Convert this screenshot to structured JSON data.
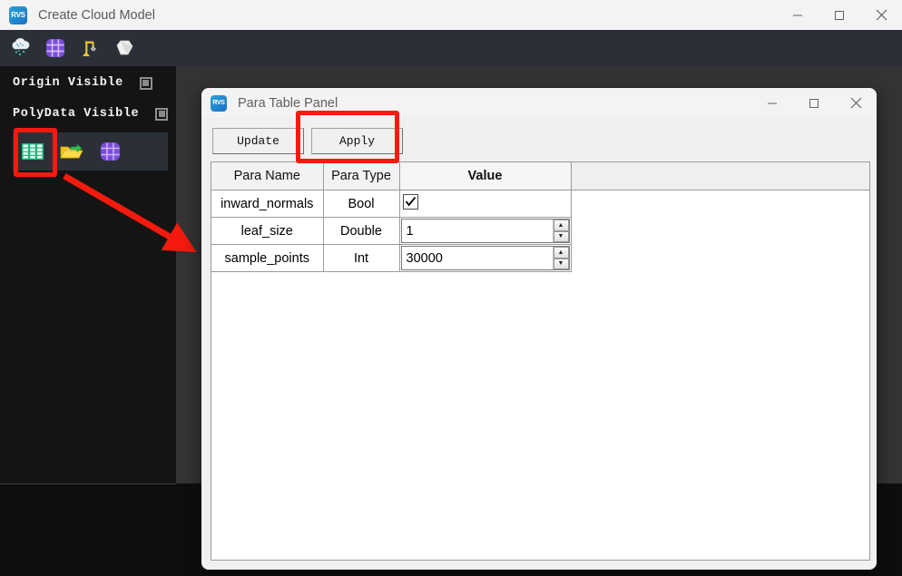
{
  "main_window": {
    "title": "Create Cloud Model",
    "icon_label": "RVS",
    "icon_name": "rvs-app-icon",
    "controls": {
      "minimize": "—",
      "maximize": "□",
      "close": "✕"
    }
  },
  "toolbar": {
    "buttons": [
      {
        "name": "point-cloud-icon",
        "glyph": "☁"
      },
      {
        "name": "grid-mesh-icon",
        "glyph": "▦"
      },
      {
        "name": "robot-arm-icon",
        "glyph": "⚒"
      },
      {
        "name": "solid-model-icon",
        "glyph": "⬟"
      }
    ]
  },
  "sidebar": {
    "origin_visible_label": "Origin Visible",
    "polydata_visible_label": "PolyData Visible",
    "strip_buttons": [
      {
        "name": "para-table-icon",
        "label": "Para Table"
      },
      {
        "name": "open-folder-icon",
        "label": "Open File"
      },
      {
        "name": "mesh-globe-icon",
        "label": "Mesh View"
      }
    ]
  },
  "annotations": {
    "highlight_color": "#f41b0e",
    "arrow_color": "#f41b0e",
    "highlighted_elements": [
      "para-table-icon",
      "apply-button"
    ]
  },
  "dialog": {
    "title": "Para Table Panel",
    "icon_label": "RVS",
    "controls": {
      "minimize": "—",
      "maximize": "□",
      "close": "✕"
    },
    "buttons": {
      "update": "Update",
      "apply": "Apply"
    },
    "table": {
      "headers": [
        "Para Name",
        "Para Type",
        "Value",
        ""
      ],
      "rows": [
        {
          "para_name": "inward_normals",
          "para_type": "Bool",
          "value": "true",
          "widget": "checkbox",
          "checked": true
        },
        {
          "para_name": "leaf_size",
          "para_type": "Double",
          "value": "1",
          "widget": "spinbox",
          "spin_up": "▲",
          "spin_down": "▼"
        },
        {
          "para_name": "sample_points",
          "para_type": "Int",
          "value": "30000",
          "widget": "spinbox",
          "spin_up": "▲",
          "spin_down": "▼"
        }
      ]
    }
  }
}
